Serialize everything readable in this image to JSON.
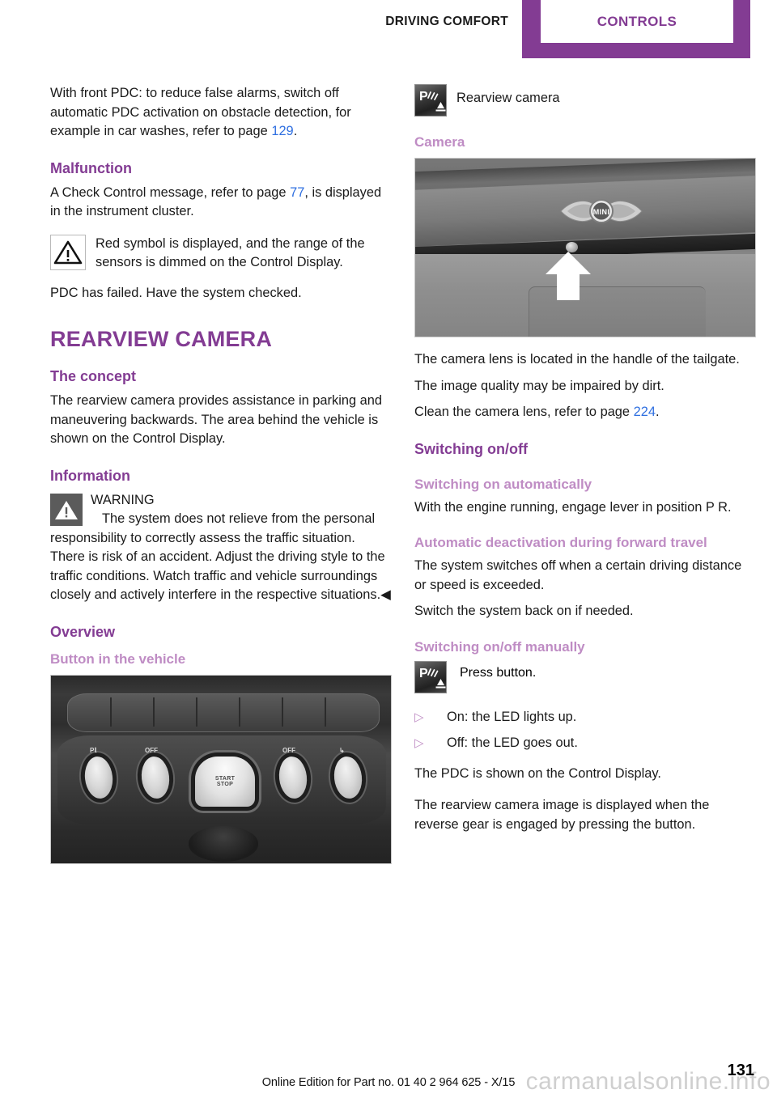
{
  "header": {
    "chapter_label": "DRIVING COMFORT",
    "tab_label": "CONTROLS",
    "accent_color": "#833c93"
  },
  "left_column": {
    "intro_paragraph_part1": "With front PDC: to reduce false alarms, switch off automatic PDC activation on obstacle detection, for example in car washes, refer to page ",
    "intro_pageref": "129",
    "intro_paragraph_part2": ".",
    "malfunction_heading": "Malfunction",
    "malfunction_text_part1": "A Check Control message, refer to page ",
    "malfunction_pageref": "77",
    "malfunction_text_part2": ", is displayed in the instrument cluster.",
    "red_symbol_note": "Red symbol is displayed, and the range of the sensors is dimmed on the Control Display.",
    "pdc_failed_text": "PDC has failed. Have the system checked.",
    "chapter_heading": "REARVIEW CAMERA",
    "concept_heading": "The concept",
    "concept_text": "The rearview camera provides assistance in parking and maneuvering backwards. The area behind the vehicle is shown on the Control Display.",
    "information_heading": "Information",
    "warning_title": "WARNING",
    "warning_text": "The system does not relieve from the personal responsibility to correctly assess the traffic situation. There is risk of an accident. Adjust the driving style to the traffic conditions. Watch traffic and vehicle surroundings closely and actively interfere in the respective situations.◀",
    "overview_heading": "Overview",
    "button_in_vehicle_heading": "Button in the vehicle",
    "console_figure": {
      "caption": "",
      "switch_labels": [
        "P",
        "OFF",
        "START STOP",
        "OFF",
        ""
      ],
      "start_stop_line1": "START",
      "start_stop_line2": "STOP",
      "auto_start_stop_label": "OFF",
      "dtc_label": "OFF"
    }
  },
  "right_column": {
    "rearview_camera_symbol_label": "Rearview camera",
    "camera_heading": "Camera",
    "camera_lens_text": "The camera lens is located in the handle of the tailgate.",
    "image_quality_text": "The image quality may be impaired by dirt.",
    "clean_lens_text_part1": "Clean the camera lens, refer to page ",
    "clean_lens_pageref": "224",
    "clean_lens_text_part2": ".",
    "switching_heading": "Switching on/off",
    "switching_auto_heading": "Switching on automatically",
    "switching_auto_text": "With the engine running, engage lever in position P R.",
    "auto_deactivation_heading": "Automatic deactivation during forward travel",
    "auto_deactivation_text": "The system switches off when a certain driving distance or speed is exceeded.",
    "switch_back_text": "Switch the system back on if needed.",
    "manual_heading": "Switching on/off manually",
    "press_button_text": "Press button.",
    "bullets": [
      {
        "marker": "▷",
        "text": "On: the LED lights up."
      },
      {
        "marker": "▷",
        "text": "Off: the LED goes out."
      }
    ],
    "pdc_shown_text": "The PDC is shown on the Control Display.",
    "reverse_gear_text": "The rearview camera image is displayed when the reverse gear is engaged by pressing the button.",
    "tailgate_figure": {
      "brand_logo_text": "MINI"
    }
  },
  "footer": {
    "edition_text": "Online Edition for Part no. 01 40 2 964 625 - X/15",
    "page_number": "131",
    "watermark_text": "carmanualsonline.info"
  }
}
